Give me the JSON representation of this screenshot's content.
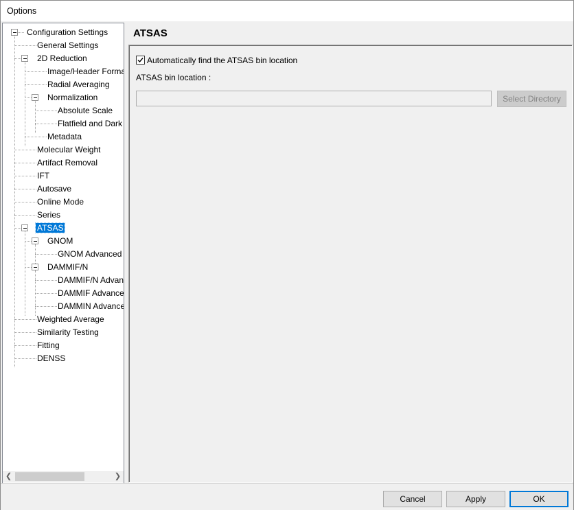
{
  "window": {
    "title": "Options"
  },
  "tree": {
    "nodes": [
      {
        "label": "Configuration Settings",
        "expanded": true
      },
      {
        "label": "General Settings"
      },
      {
        "label": "2D Reduction",
        "expanded": true
      },
      {
        "label": "Image/Header Format"
      },
      {
        "label": "Radial Averaging"
      },
      {
        "label": "Normalization",
        "expanded": true
      },
      {
        "label": "Absolute Scale"
      },
      {
        "label": "Flatfield and Dark"
      },
      {
        "label": "Metadata"
      },
      {
        "label": "Molecular Weight"
      },
      {
        "label": "Artifact Removal"
      },
      {
        "label": "IFT"
      },
      {
        "label": "Autosave"
      },
      {
        "label": "Online Mode"
      },
      {
        "label": "Series"
      },
      {
        "label": "ATSAS",
        "expanded": true,
        "selected": true
      },
      {
        "label": "GNOM",
        "expanded": true
      },
      {
        "label": "GNOM Advanced"
      },
      {
        "label": "DAMMIF/N",
        "expanded": true
      },
      {
        "label": "DAMMIF/N Advanced"
      },
      {
        "label": "DAMMIF Advanced"
      },
      {
        "label": "DAMMIN Advanced"
      },
      {
        "label": "Weighted Average"
      },
      {
        "label": "Similarity Testing"
      },
      {
        "label": "Fitting"
      },
      {
        "label": "DENSS"
      }
    ],
    "scroll_left_icon": "chevron-left-icon",
    "scroll_right_icon": "chevron-right-icon"
  },
  "page": {
    "title": "ATSAS",
    "auto_find_label": "Automatically find the ATSAS bin location",
    "auto_find_checked": true,
    "bin_location_label": "ATSAS bin location :",
    "bin_location_value": "",
    "select_directory_label": "Select Directory"
  },
  "buttons": {
    "cancel": "Cancel",
    "apply": "Apply",
    "ok": "OK"
  },
  "colors": {
    "selection": "#0078d7",
    "background": "#f0f0f0"
  }
}
